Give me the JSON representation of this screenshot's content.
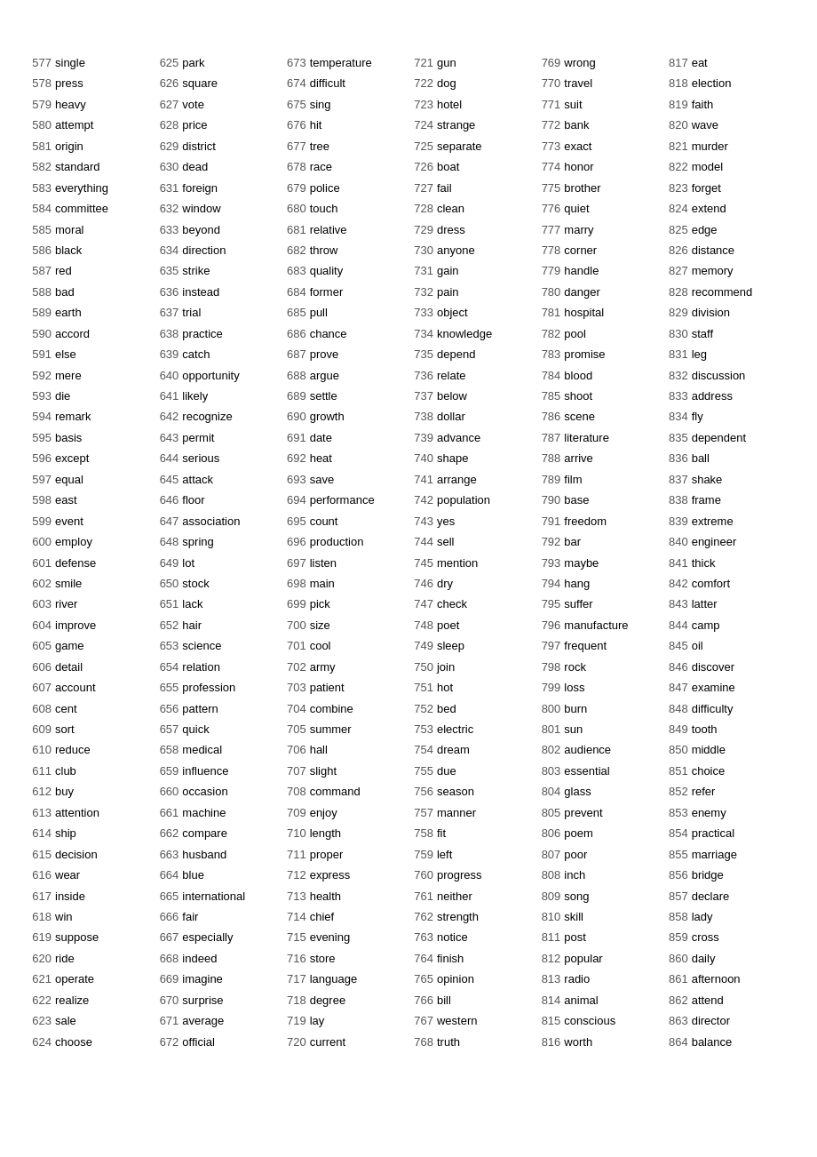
{
  "columns": [
    [
      {
        "num": "577",
        "word": "single"
      },
      {
        "num": "578",
        "word": "press"
      },
      {
        "num": "579",
        "word": "heavy"
      },
      {
        "num": "580",
        "word": "attempt"
      },
      {
        "num": "581",
        "word": "origin"
      },
      {
        "num": "582",
        "word": "standard"
      },
      {
        "num": "583",
        "word": "everything"
      },
      {
        "num": "584",
        "word": "committee"
      },
      {
        "num": "585",
        "word": "moral"
      },
      {
        "num": "586",
        "word": "black"
      },
      {
        "num": "587",
        "word": "red"
      },
      {
        "num": "588",
        "word": "bad"
      },
      {
        "num": "589",
        "word": "earth"
      },
      {
        "num": "590",
        "word": "accord"
      },
      {
        "num": "591",
        "word": "else"
      },
      {
        "num": "592",
        "word": "mere"
      },
      {
        "num": "593",
        "word": "die"
      },
      {
        "num": "594",
        "word": "remark"
      },
      {
        "num": "595",
        "word": "basis"
      },
      {
        "num": "596",
        "word": "except"
      },
      {
        "num": "597",
        "word": "equal"
      },
      {
        "num": "598",
        "word": "east"
      },
      {
        "num": "599",
        "word": "event"
      },
      {
        "num": "600",
        "word": "employ"
      },
      {
        "num": "601",
        "word": "defense"
      },
      {
        "num": "602",
        "word": "smile"
      },
      {
        "num": "603",
        "word": "river"
      },
      {
        "num": "604",
        "word": "improve"
      },
      {
        "num": "605",
        "word": "game"
      },
      {
        "num": "606",
        "word": "detail"
      },
      {
        "num": "607",
        "word": "account"
      },
      {
        "num": "608",
        "word": "cent"
      },
      {
        "num": "609",
        "word": "sort"
      },
      {
        "num": "610",
        "word": "reduce"
      },
      {
        "num": "611",
        "word": "club"
      },
      {
        "num": "612",
        "word": "buy"
      },
      {
        "num": "613",
        "word": "attention"
      },
      {
        "num": "614",
        "word": "ship"
      },
      {
        "num": "615",
        "word": "decision"
      },
      {
        "num": "616",
        "word": "wear"
      },
      {
        "num": "617",
        "word": "inside"
      },
      {
        "num": "618",
        "word": "win"
      },
      {
        "num": "619",
        "word": "suppose"
      },
      {
        "num": "620",
        "word": "ride"
      },
      {
        "num": "621",
        "word": "operate"
      },
      {
        "num": "622",
        "word": "realize"
      },
      {
        "num": "623",
        "word": "sale"
      },
      {
        "num": "624",
        "word": "choose"
      }
    ],
    [
      {
        "num": "625",
        "word": "park"
      },
      {
        "num": "626",
        "word": "square"
      },
      {
        "num": "627",
        "word": "vote"
      },
      {
        "num": "628",
        "word": "price"
      },
      {
        "num": "629",
        "word": "district"
      },
      {
        "num": "630",
        "word": "dead"
      },
      {
        "num": "631",
        "word": "foreign"
      },
      {
        "num": "632",
        "word": "window"
      },
      {
        "num": "633",
        "word": "beyond"
      },
      {
        "num": "634",
        "word": "direction"
      },
      {
        "num": "635",
        "word": "strike"
      },
      {
        "num": "636",
        "word": "instead"
      },
      {
        "num": "637",
        "word": "trial"
      },
      {
        "num": "638",
        "word": "practice"
      },
      {
        "num": "639",
        "word": "catch"
      },
      {
        "num": "640",
        "word": "opportunity"
      },
      {
        "num": "641",
        "word": "likely"
      },
      {
        "num": "642",
        "word": "recognize"
      },
      {
        "num": "643",
        "word": "permit"
      },
      {
        "num": "644",
        "word": "serious"
      },
      {
        "num": "645",
        "word": "attack"
      },
      {
        "num": "646",
        "word": "floor"
      },
      {
        "num": "647",
        "word": "association"
      },
      {
        "num": "648",
        "word": "spring"
      },
      {
        "num": "649",
        "word": "lot"
      },
      {
        "num": "650",
        "word": "stock"
      },
      {
        "num": "651",
        "word": "lack"
      },
      {
        "num": "652",
        "word": "hair"
      },
      {
        "num": "653",
        "word": "science"
      },
      {
        "num": "654",
        "word": "relation"
      },
      {
        "num": "655",
        "word": "profession"
      },
      {
        "num": "656",
        "word": "pattern"
      },
      {
        "num": "657",
        "word": "quick"
      },
      {
        "num": "658",
        "word": "medical"
      },
      {
        "num": "659",
        "word": "influence"
      },
      {
        "num": "660",
        "word": "occasion"
      },
      {
        "num": "661",
        "word": "machine"
      },
      {
        "num": "662",
        "word": "compare"
      },
      {
        "num": "663",
        "word": "husband"
      },
      {
        "num": "664",
        "word": "blue"
      },
      {
        "num": "665",
        "word": "international"
      },
      {
        "num": "666",
        "word": "fair"
      },
      {
        "num": "667",
        "word": "especially"
      },
      {
        "num": "668",
        "word": "indeed"
      },
      {
        "num": "669",
        "word": "imagine"
      },
      {
        "num": "670",
        "word": "surprise"
      },
      {
        "num": "671",
        "word": "average"
      },
      {
        "num": "672",
        "word": "official"
      }
    ],
    [
      {
        "num": "673",
        "word": "temperature"
      },
      {
        "num": "674",
        "word": "difficult"
      },
      {
        "num": "675",
        "word": "sing"
      },
      {
        "num": "676",
        "word": "hit"
      },
      {
        "num": "677",
        "word": "tree"
      },
      {
        "num": "678",
        "word": "race"
      },
      {
        "num": "679",
        "word": "police"
      },
      {
        "num": "680",
        "word": "touch"
      },
      {
        "num": "681",
        "word": "relative"
      },
      {
        "num": "682",
        "word": "throw"
      },
      {
        "num": "683",
        "word": "quality"
      },
      {
        "num": "684",
        "word": "former"
      },
      {
        "num": "685",
        "word": "pull"
      },
      {
        "num": "686",
        "word": "chance"
      },
      {
        "num": "687",
        "word": "prove"
      },
      {
        "num": "688",
        "word": "argue"
      },
      {
        "num": "689",
        "word": "settle"
      },
      {
        "num": "690",
        "word": "growth"
      },
      {
        "num": "691",
        "word": "date"
      },
      {
        "num": "692",
        "word": "heat"
      },
      {
        "num": "693",
        "word": "save"
      },
      {
        "num": "694",
        "word": "performance"
      },
      {
        "num": "695",
        "word": "count"
      },
      {
        "num": "696",
        "word": "production"
      },
      {
        "num": "697",
        "word": "listen"
      },
      {
        "num": "698",
        "word": "main"
      },
      {
        "num": "699",
        "word": "pick"
      },
      {
        "num": "700",
        "word": "size"
      },
      {
        "num": "701",
        "word": "cool"
      },
      {
        "num": "702",
        "word": "army"
      },
      {
        "num": "703",
        "word": "patient"
      },
      {
        "num": "704",
        "word": "combine"
      },
      {
        "num": "705",
        "word": "summer"
      },
      {
        "num": "706",
        "word": "hall"
      },
      {
        "num": "707",
        "word": "slight"
      },
      {
        "num": "708",
        "word": "command"
      },
      {
        "num": "709",
        "word": "enjoy"
      },
      {
        "num": "710",
        "word": "length"
      },
      {
        "num": "711",
        "word": "proper"
      },
      {
        "num": "712",
        "word": "express"
      },
      {
        "num": "713",
        "word": "health"
      },
      {
        "num": "714",
        "word": "chief"
      },
      {
        "num": "715",
        "word": "evening"
      },
      {
        "num": "716",
        "word": "store"
      },
      {
        "num": "717",
        "word": "language"
      },
      {
        "num": "718",
        "word": "degree"
      },
      {
        "num": "719",
        "word": "lay"
      },
      {
        "num": "720",
        "word": "current"
      }
    ],
    [
      {
        "num": "721",
        "word": "gun"
      },
      {
        "num": "722",
        "word": "dog"
      },
      {
        "num": "723",
        "word": "hotel"
      },
      {
        "num": "724",
        "word": "strange"
      },
      {
        "num": "725",
        "word": "separate"
      },
      {
        "num": "726",
        "word": "boat"
      },
      {
        "num": "727",
        "word": "fail"
      },
      {
        "num": "728",
        "word": "clean"
      },
      {
        "num": "729",
        "word": "dress"
      },
      {
        "num": "730",
        "word": "anyone"
      },
      {
        "num": "731",
        "word": "gain"
      },
      {
        "num": "732",
        "word": "pain"
      },
      {
        "num": "733",
        "word": "object"
      },
      {
        "num": "734",
        "word": "knowledge"
      },
      {
        "num": "735",
        "word": "depend"
      },
      {
        "num": "736",
        "word": "relate"
      },
      {
        "num": "737",
        "word": "below"
      },
      {
        "num": "738",
        "word": "dollar"
      },
      {
        "num": "739",
        "word": "advance"
      },
      {
        "num": "740",
        "word": "shape"
      },
      {
        "num": "741",
        "word": "arrange"
      },
      {
        "num": "742",
        "word": "population"
      },
      {
        "num": "743",
        "word": "yes"
      },
      {
        "num": "744",
        "word": "sell"
      },
      {
        "num": "745",
        "word": "mention"
      },
      {
        "num": "746",
        "word": "dry"
      },
      {
        "num": "747",
        "word": "check"
      },
      {
        "num": "748",
        "word": "poet"
      },
      {
        "num": "749",
        "word": "sleep"
      },
      {
        "num": "750",
        "word": "join"
      },
      {
        "num": "751",
        "word": "hot"
      },
      {
        "num": "752",
        "word": "bed"
      },
      {
        "num": "753",
        "word": "electric"
      },
      {
        "num": "754",
        "word": "dream"
      },
      {
        "num": "755",
        "word": "due"
      },
      {
        "num": "756",
        "word": "season"
      },
      {
        "num": "757",
        "word": "manner"
      },
      {
        "num": "758",
        "word": "fit"
      },
      {
        "num": "759",
        "word": "left"
      },
      {
        "num": "760",
        "word": "progress"
      },
      {
        "num": "761",
        "word": "neither"
      },
      {
        "num": "762",
        "word": "strength"
      },
      {
        "num": "763",
        "word": "notice"
      },
      {
        "num": "764",
        "word": "finish"
      },
      {
        "num": "765",
        "word": "opinion"
      },
      {
        "num": "766",
        "word": "bill"
      },
      {
        "num": "767",
        "word": "western"
      },
      {
        "num": "768",
        "word": "truth"
      }
    ],
    [
      {
        "num": "769",
        "word": "wrong"
      },
      {
        "num": "770",
        "word": "travel"
      },
      {
        "num": "771",
        "word": "suit"
      },
      {
        "num": "772",
        "word": "bank"
      },
      {
        "num": "773",
        "word": "exact"
      },
      {
        "num": "774",
        "word": "honor"
      },
      {
        "num": "775",
        "word": "brother"
      },
      {
        "num": "776",
        "word": "quiet"
      },
      {
        "num": "777",
        "word": "marry"
      },
      {
        "num": "778",
        "word": "corner"
      },
      {
        "num": "779",
        "word": "handle"
      },
      {
        "num": "780",
        "word": "danger"
      },
      {
        "num": "781",
        "word": "hospital"
      },
      {
        "num": "782",
        "word": "pool"
      },
      {
        "num": "783",
        "word": "promise"
      },
      {
        "num": "784",
        "word": "blood"
      },
      {
        "num": "785",
        "word": "shoot"
      },
      {
        "num": "786",
        "word": "scene"
      },
      {
        "num": "787",
        "word": "literature"
      },
      {
        "num": "788",
        "word": "arrive"
      },
      {
        "num": "789",
        "word": "film"
      },
      {
        "num": "790",
        "word": "base"
      },
      {
        "num": "791",
        "word": "freedom"
      },
      {
        "num": "792",
        "word": "bar"
      },
      {
        "num": "793",
        "word": "maybe"
      },
      {
        "num": "794",
        "word": "hang"
      },
      {
        "num": "795",
        "word": "suffer"
      },
      {
        "num": "796",
        "word": "manufacture"
      },
      {
        "num": "797",
        "word": "frequent"
      },
      {
        "num": "798",
        "word": "rock"
      },
      {
        "num": "799",
        "word": "loss"
      },
      {
        "num": "800",
        "word": "burn"
      },
      {
        "num": "801",
        "word": "sun"
      },
      {
        "num": "802",
        "word": "audience"
      },
      {
        "num": "803",
        "word": "essential"
      },
      {
        "num": "804",
        "word": "glass"
      },
      {
        "num": "805",
        "word": "prevent"
      },
      {
        "num": "806",
        "word": "poem"
      },
      {
        "num": "807",
        "word": "poor"
      },
      {
        "num": "808",
        "word": "inch"
      },
      {
        "num": "809",
        "word": "song"
      },
      {
        "num": "810",
        "word": "skill"
      },
      {
        "num": "811",
        "word": "post"
      },
      {
        "num": "812",
        "word": "popular"
      },
      {
        "num": "813",
        "word": "radio"
      },
      {
        "num": "814",
        "word": "animal"
      },
      {
        "num": "815",
        "word": "conscious"
      },
      {
        "num": "816",
        "word": "worth"
      }
    ],
    [
      {
        "num": "817",
        "word": "eat"
      },
      {
        "num": "818",
        "word": "election"
      },
      {
        "num": "819",
        "word": "faith"
      },
      {
        "num": "820",
        "word": "wave"
      },
      {
        "num": "821",
        "word": "murder"
      },
      {
        "num": "822",
        "word": "model"
      },
      {
        "num": "823",
        "word": "forget"
      },
      {
        "num": "824",
        "word": "extend"
      },
      {
        "num": "825",
        "word": "edge"
      },
      {
        "num": "826",
        "word": "distance"
      },
      {
        "num": "827",
        "word": "memory"
      },
      {
        "num": "828",
        "word": "recommend"
      },
      {
        "num": "829",
        "word": "division"
      },
      {
        "num": "830",
        "word": "staff"
      },
      {
        "num": "831",
        "word": "leg"
      },
      {
        "num": "832",
        "word": "discussion"
      },
      {
        "num": "833",
        "word": "address"
      },
      {
        "num": "834",
        "word": "fly"
      },
      {
        "num": "835",
        "word": "dependent"
      },
      {
        "num": "836",
        "word": "ball"
      },
      {
        "num": "837",
        "word": "shake"
      },
      {
        "num": "838",
        "word": "frame"
      },
      {
        "num": "839",
        "word": "extreme"
      },
      {
        "num": "840",
        "word": "engineer"
      },
      {
        "num": "841",
        "word": "thick"
      },
      {
        "num": "842",
        "word": "comfort"
      },
      {
        "num": "843",
        "word": "latter"
      },
      {
        "num": "844",
        "word": "camp"
      },
      {
        "num": "845",
        "word": "oil"
      },
      {
        "num": "846",
        "word": "discover"
      },
      {
        "num": "847",
        "word": "examine"
      },
      {
        "num": "848",
        "word": "difficulty"
      },
      {
        "num": "849",
        "word": "tooth"
      },
      {
        "num": "850",
        "word": "middle"
      },
      {
        "num": "851",
        "word": "choice"
      },
      {
        "num": "852",
        "word": "refer"
      },
      {
        "num": "853",
        "word": "enemy"
      },
      {
        "num": "854",
        "word": "practical"
      },
      {
        "num": "855",
        "word": "marriage"
      },
      {
        "num": "856",
        "word": "bridge"
      },
      {
        "num": "857",
        "word": "declare"
      },
      {
        "num": "858",
        "word": "lady"
      },
      {
        "num": "859",
        "word": "cross"
      },
      {
        "num": "860",
        "word": "daily"
      },
      {
        "num": "861",
        "word": "afternoon"
      },
      {
        "num": "862",
        "word": "attend"
      },
      {
        "num": "863",
        "word": "director"
      },
      {
        "num": "864",
        "word": "balance"
      }
    ]
  ]
}
